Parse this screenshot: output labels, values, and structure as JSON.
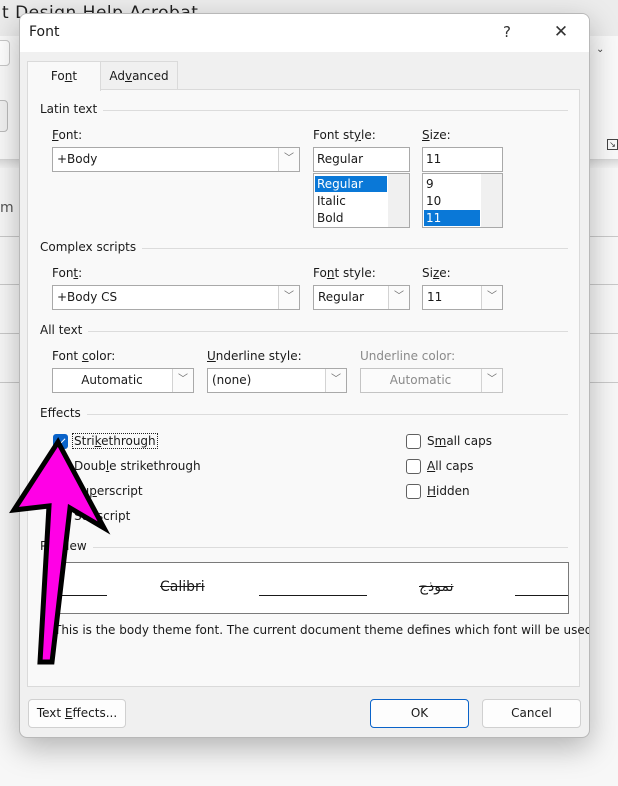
{
  "background_app": {
    "menu_text": "t   Design   Help   Acrobat",
    "doc_fragment": "m",
    "launcher_icon": "dialog-launcher-icon"
  },
  "dialog": {
    "title": "Font",
    "help_label": "?",
    "close_label": "✕",
    "tabs": [
      {
        "label_pre": "Fo",
        "label_mnemonic": "n",
        "label_post": "t",
        "active": true
      },
      {
        "label_pre": "Ad",
        "label_mnemonic": "v",
        "label_post": "anced",
        "active": false
      }
    ],
    "latin_text": {
      "group_label": "Latin text",
      "font_label": {
        "mnemonic": "F",
        "rest": "ont:"
      },
      "font_value": "+Body",
      "style_label": {
        "pre": "Font st",
        "mnemonic": "y",
        "post": "le:"
      },
      "style_value": "Regular",
      "style_options": [
        "Regular",
        "Italic",
        "Bold"
      ],
      "style_selected": "Regular",
      "size_label": {
        "mnemonic": "S",
        "rest": "ize:"
      },
      "size_value": "11",
      "size_options": [
        "9",
        "10",
        "11"
      ],
      "size_selected": "11"
    },
    "complex_scripts": {
      "group_label": "Complex scripts",
      "font_label": {
        "pre": "Fon",
        "mnemonic": "t",
        "post": ":"
      },
      "font_value": "+Body CS",
      "style_label": {
        "pre": "Fo",
        "mnemonic": "n",
        "post": "t style:"
      },
      "style_value": "Regular",
      "size_label": {
        "pre": "Si",
        "mnemonic": "z",
        "post": "e:"
      },
      "size_value": "11"
    },
    "all_text": {
      "group_label": "All text",
      "font_color_label": {
        "pre": "Font ",
        "mnemonic": "c",
        "post": "olor:"
      },
      "font_color_value": "Automatic",
      "underline_style_label": {
        "mnemonic": "U",
        "rest": "nderline style:"
      },
      "underline_style_value": "(none)",
      "underline_color_label": "Underline color:",
      "underline_color_value": "Automatic"
    },
    "effects": {
      "group_label": "Effects",
      "left": [
        {
          "pre": "Stri",
          "mnemonic": "k",
          "post": "ethrough",
          "checked": true,
          "focused": true
        },
        {
          "pre": "Doub",
          "mnemonic": "l",
          "post": "e strikethrough",
          "checked": false
        },
        {
          "pre": "Su",
          "mnemonic": "p",
          "post": "erscript",
          "checked": false
        },
        {
          "pre": "Su",
          "mnemonic": "b",
          "post": "script",
          "checked": false
        }
      ],
      "right": [
        {
          "pre": "S",
          "mnemonic": "m",
          "post": "all caps",
          "checked": false
        },
        {
          "pre": "",
          "mnemonic": "A",
          "post": "ll caps",
          "checked": false
        },
        {
          "pre": "",
          "mnemonic": "H",
          "post": "idden",
          "checked": false
        }
      ]
    },
    "preview": {
      "group_label": "Preview",
      "latin_sample": "Calibri",
      "complex_sample": "نموذج",
      "note": "This is the body theme font. The current document theme defines which font will be used."
    },
    "buttons": {
      "text_effects": {
        "pre": "Text ",
        "mnemonic": "E",
        "post": "ffects..."
      },
      "ok": "OK",
      "cancel": "Cancel"
    }
  },
  "annotation": {
    "arrow_color": "#ff00e6",
    "outline_color": "#000000",
    "points_to": "strikethrough-checkbox"
  }
}
